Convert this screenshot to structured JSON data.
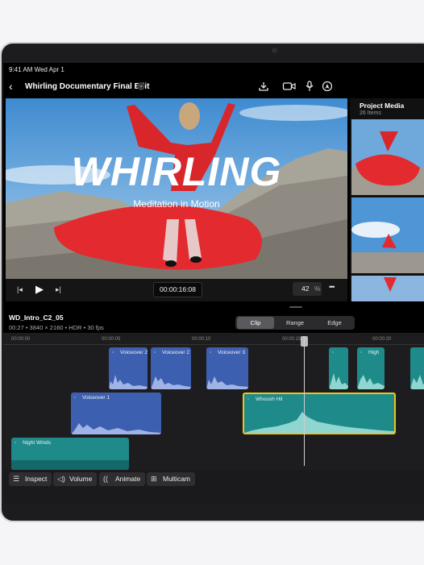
{
  "status": {
    "time_date": "9:41 AM  Wed Apr 1"
  },
  "header": {
    "back_icon": "chevron-left-icon",
    "project_title": "Whirling Documentary Final Edit"
  },
  "viewer": {
    "headline": "WHIRLING",
    "subtitle": "Meditation in Motion"
  },
  "transport": {
    "timecode": "00:00:16:08",
    "zoom_value": "42",
    "zoom_unit": "%",
    "more": "•••"
  },
  "media": {
    "title": "Project Media",
    "count": "26 Items"
  },
  "clip_info": {
    "name": "WD_Intro_C2_05",
    "meta": "00:27 • 3840 × 2160 • HDR • 30 fps"
  },
  "segments": {
    "clip": "Clip",
    "range": "Range",
    "edge": "Edge",
    "selected": "Clip"
  },
  "ruler": {
    "t0": "00:00:00",
    "t1": "00:00:05",
    "t2": "00:00:10",
    "t3": "00:00:15",
    "t4": "00:00:20"
  },
  "clips": {
    "vo2a": "Voiceover 2",
    "vo2b": "Voiceover 2",
    "vo3": "Voiceover 3",
    "high": "High",
    "vo1": "Voiceover 1",
    "whoosh": "Whoosh Hit",
    "night": "Night Winds"
  },
  "bottom_toolbar": {
    "inspect": "Inspect",
    "volume": "Volume",
    "animate": "Animate",
    "multicam": "Multicam"
  },
  "colors": {
    "voiceover": "#3d5fb0",
    "sfx": "#1f8a8a",
    "selected_border": "#f0c419",
    "sky": "#5b9fd8",
    "robe": "#e32a2f"
  }
}
